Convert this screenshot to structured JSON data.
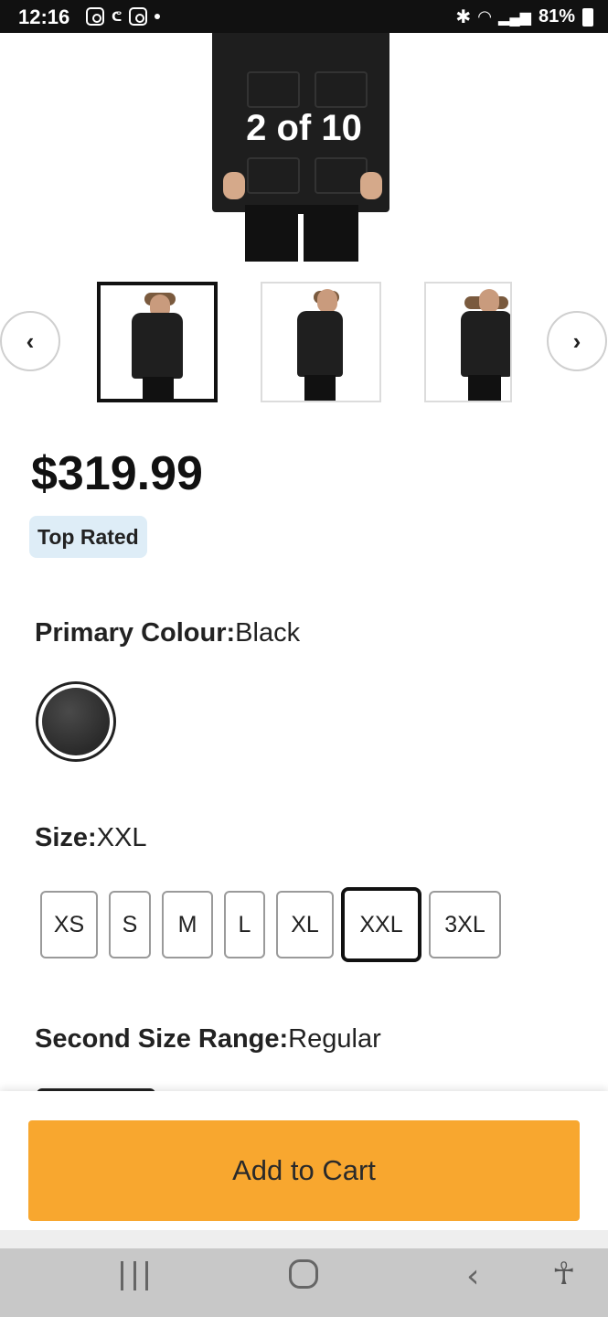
{
  "status_bar": {
    "time": "12:16",
    "notification_extra": "ᕦ",
    "battery": "81%",
    "bluetooth_icon": "bluetooth-icon",
    "wifi_icon": "wifi-icon",
    "signal_icon": "signal-icon"
  },
  "gallery": {
    "counter": "2 of 10",
    "prev_symbol": "‹",
    "next_symbol": "›",
    "thumbnails": [
      "front",
      "side",
      "back"
    ],
    "selected_thumbnail": 0
  },
  "product": {
    "price": "$319.99",
    "badge": "Top Rated"
  },
  "colour": {
    "label": "Primary Colour:",
    "value": "Black",
    "swatch_color": "#2f2f2f"
  },
  "size": {
    "label": "Size:",
    "value": "XXL",
    "options": [
      "XS",
      "S",
      "M",
      "L",
      "XL",
      "XXL",
      "3XL"
    ],
    "selected": "XXL"
  },
  "size_range": {
    "label": "Second Size Range:",
    "value": "Regular"
  },
  "cart": {
    "add_to_cart_label": "Add to Cart",
    "button_color": "#f8a72f"
  },
  "android_nav": {
    "back_symbol": "‹",
    "accessibility_symbol": "☥"
  }
}
